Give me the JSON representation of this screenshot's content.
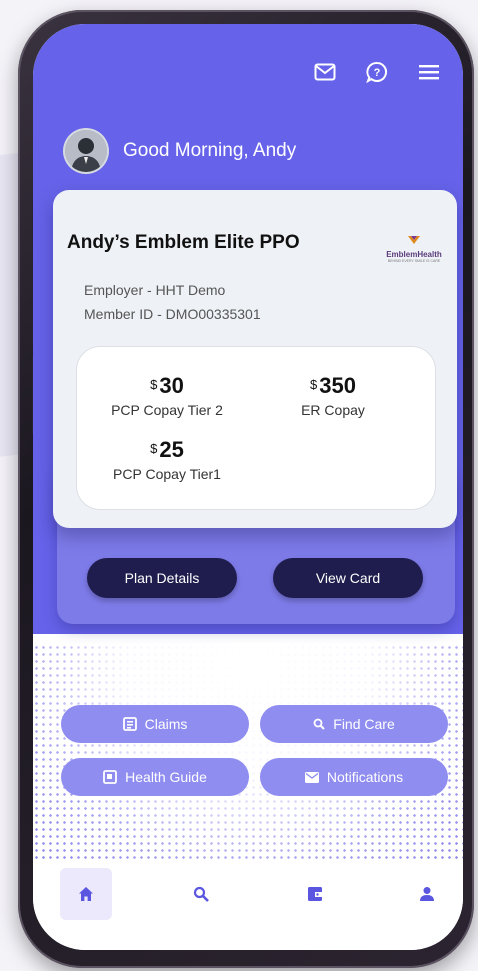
{
  "header": {
    "greeting": "Good Morning, Andy",
    "icons": [
      "mail-icon",
      "help-chat-icon",
      "menu-icon"
    ],
    "accent_color": "#6663ea"
  },
  "card": {
    "plan_name": "Andy’s Emblem Elite PPO",
    "logo_text": "EmblemHealth",
    "logo_tagline": "BEHIND EVERY SMILE IS CARE",
    "employer": "Employer - HHT Demo",
    "member_id": "Member ID - DMO00335301",
    "copays": [
      {
        "currency": "$",
        "amount": "30",
        "label": "PCP Copay Tier 2"
      },
      {
        "currency": "$",
        "amount": "350",
        "label": "ER Copay"
      },
      {
        "currency": "$",
        "amount": "25",
        "label": "PCP Copay Tier1"
      }
    ]
  },
  "actions": {
    "plan_details": "Plan Details",
    "view_card": "View Card"
  },
  "quick_links": [
    {
      "label": "Claims",
      "icon": "document-icon"
    },
    {
      "label": "Find Care",
      "icon": "search-icon"
    },
    {
      "label": "Health Guide",
      "icon": "guide-icon"
    },
    {
      "label": "Notifications",
      "icon": "mail-icon"
    }
  ],
  "tabbar": {
    "tabs": [
      {
        "icon": "home-icon",
        "active": true
      },
      {
        "icon": "search-icon",
        "active": false
      },
      {
        "icon": "wallet-icon",
        "active": false
      },
      {
        "icon": "profile-icon",
        "active": false
      }
    ]
  }
}
